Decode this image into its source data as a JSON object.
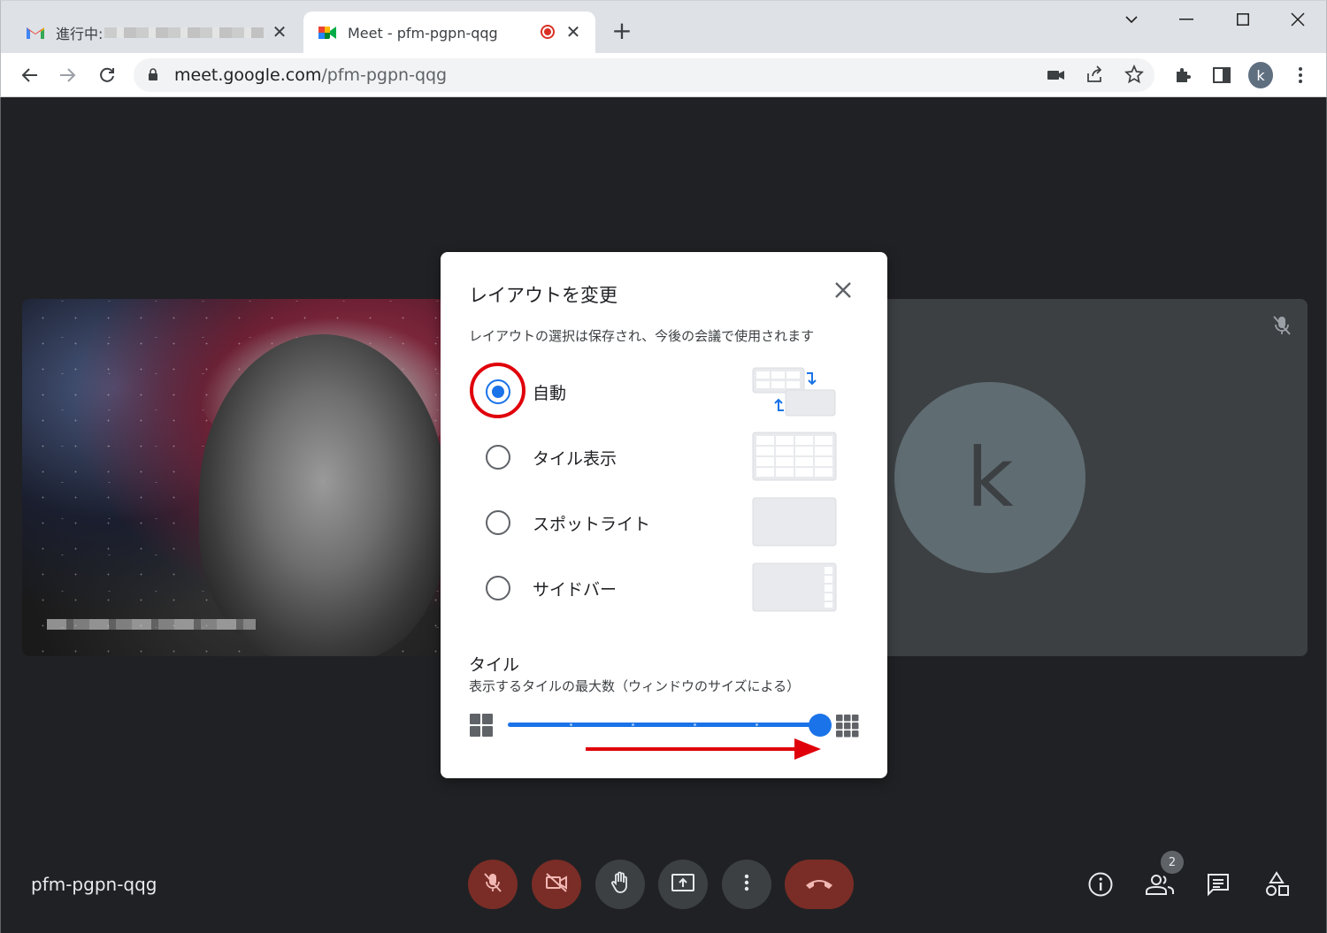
{
  "browser": {
    "tabs": [
      {
        "title": "進行中:",
        "active": false
      },
      {
        "title": "Meet - pfm-pgpn-qqg",
        "active": true
      }
    ],
    "url_host": "meet.google.com",
    "url_path": "/pfm-pgpn-qqg",
    "profile_initial": "k"
  },
  "meeting": {
    "code": "pfm-pgpn-qqg",
    "participant_initial": "k",
    "participants_count": "2"
  },
  "dialog": {
    "title": "レイアウトを変更",
    "subtitle": "レイアウトの選択は保存され、今後の会議で使用されます",
    "options": [
      {
        "label": "自動",
        "selected": true,
        "thumb": "auto-layout-icon"
      },
      {
        "label": "タイル表示",
        "selected": false,
        "thumb": "tiled-layout-icon"
      },
      {
        "label": "スポットライト",
        "selected": false,
        "thumb": "spotlight-layout-icon"
      },
      {
        "label": "サイドバー",
        "selected": false,
        "thumb": "sidebar-layout-icon"
      }
    ],
    "tiles_section_title": "タイル",
    "tiles_section_subtitle": "表示するタイルの最大数（ウィンドウのサイズによる）",
    "tiles_slider_value": 1.0
  },
  "colors": {
    "accent": "#1a73e8",
    "annotation_red": "#e0000a",
    "stage_bg": "#202124",
    "control_red": "#7a2d26"
  }
}
